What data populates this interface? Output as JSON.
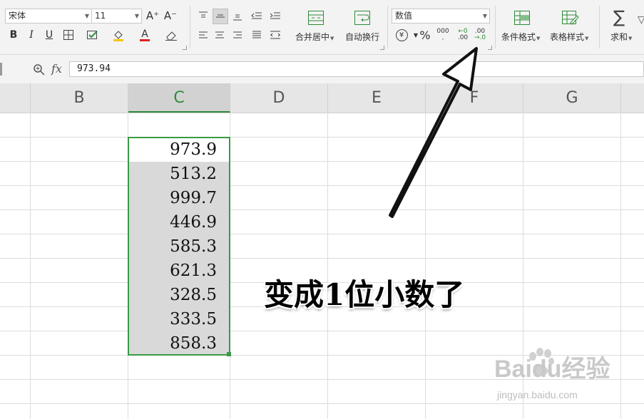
{
  "ribbon": {
    "font_name": "宋体",
    "font_size": "11",
    "number_format": "数值",
    "merge_center_label": "合并居中",
    "wrap_text_label": "自动换行",
    "conditional_format_label": "条件格式",
    "table_style_label": "表格样式",
    "sum_label": "求和",
    "bold": "B",
    "italic": "I",
    "underline": "U",
    "grow_font": "A⁺",
    "shrink_font": "A⁻",
    "font_color": "A",
    "currency": "¥",
    "percent": "%",
    "thousands": "000",
    "increase_decimal_top": "←0",
    "increase_decimal_bottom": ".00",
    "decrease_decimal_top": ".00",
    "decrease_decimal_bottom": "→.0"
  },
  "formula_bar": {
    "fx_label": "fx",
    "value": "973.94"
  },
  "columns": [
    "B",
    "C",
    "D",
    "E",
    "F",
    "G"
  ],
  "selected_column": "C",
  "cells": [
    "973.9",
    "513.2",
    "999.7",
    "446.9",
    "585.3",
    "621.3",
    "328.5",
    "333.5",
    "858.3"
  ],
  "annotation": "变成1位小数了",
  "watermark": {
    "brand": "Baidu经验",
    "url": "jingyan.baidu.com"
  },
  "colors": {
    "selection_green": "#3a9b46",
    "ribbon_bg": "#f3f3f3",
    "header_bg": "#e6e6e6"
  }
}
